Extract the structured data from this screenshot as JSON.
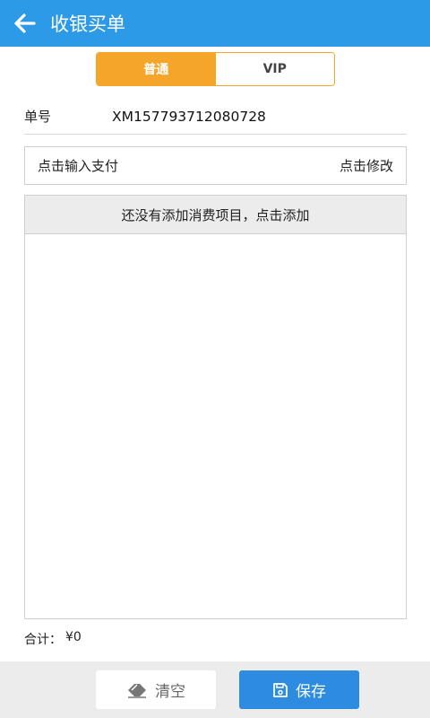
{
  "header": {
    "title": "收银买单"
  },
  "segments": [
    {
      "label": "普通",
      "active": true
    },
    {
      "label": "VIP",
      "active": false
    }
  ],
  "order": {
    "label": "单号",
    "value": "XM157793712080728"
  },
  "payment": {
    "input_label": "点击输入支付",
    "modify_label": "点击修改"
  },
  "items": {
    "empty_prompt": "还没有添加消费项目，点击添加"
  },
  "total": {
    "label": "合计：",
    "value": "¥0"
  },
  "actions": {
    "clear_label": "清空",
    "save_label": "保存"
  },
  "colors": {
    "header": "#2d9ae8",
    "accent": "#f4a52a",
    "primary_button": "#2d8ce0"
  },
  "icons": {
    "back": "arrow-left-icon",
    "clear": "eraser-icon",
    "save": "floppy-disk-icon"
  }
}
